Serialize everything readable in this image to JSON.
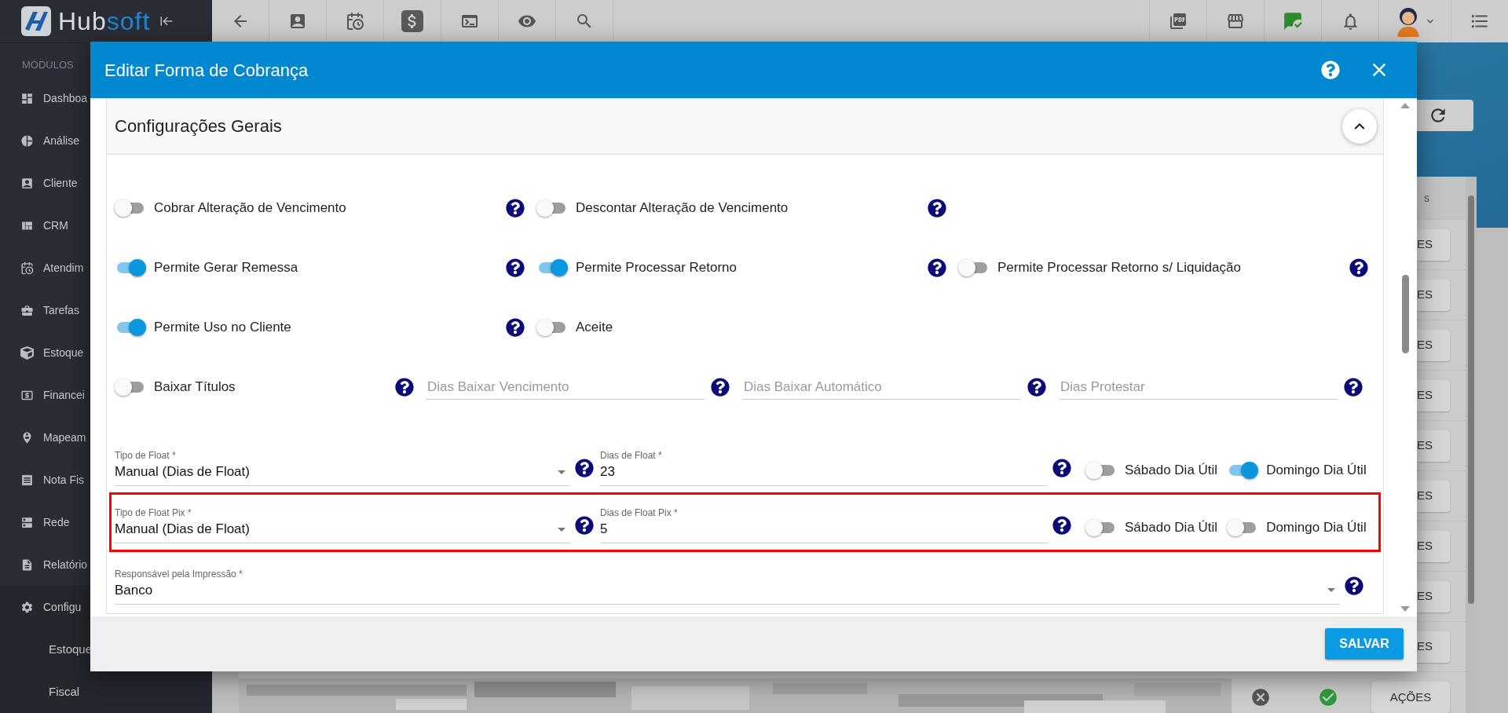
{
  "logo": {
    "first": "Hub",
    "second": "soft"
  },
  "toolbar": {
    "left": [
      {
        "selected": false
      },
      {
        "selected": false
      },
      {
        "selected": false
      },
      {
        "selected": true
      },
      {
        "selected": false
      },
      {
        "selected": false
      },
      {
        "selected": false
      }
    ]
  },
  "sidebar": {
    "heading": "MÓDULOS",
    "items": [
      {
        "label": "Dashboa"
      },
      {
        "label": "Análise"
      },
      {
        "label": "Cliente"
      },
      {
        "label": "CRM"
      },
      {
        "label": "Atendim"
      },
      {
        "label": "Tarefas"
      },
      {
        "label": "Estoque"
      },
      {
        "label": "Financei"
      },
      {
        "label": "Mapeam"
      },
      {
        "label": "Nota Fis"
      },
      {
        "label": "Rede"
      },
      {
        "label": "Relatório"
      },
      {
        "label": "Configu",
        "expanded": true,
        "children": [
          {
            "label": "Estoque"
          },
          {
            "label": "Fiscal"
          }
        ]
      }
    ]
  },
  "background_table": {
    "header": "s",
    "row_buttons": [
      "ES",
      "ES",
      "ES",
      "ES",
      "ES",
      "ES",
      "ES",
      "ES",
      "ES"
    ],
    "last_row_button": "AÇÕES"
  },
  "modal": {
    "title": "Editar Forma de Cobrança",
    "section": {
      "title": "Configurações Gerais",
      "expanded": true
    },
    "rows": [
      {
        "highlighted": false,
        "items": [
          {
            "kind": "toggle",
            "label": "Cobrar Alteração de Vencimento",
            "on": false,
            "help": true
          },
          {
            "kind": "toggle",
            "label": "Descontar Alteração de Vencimento",
            "on": false,
            "help": true
          }
        ]
      },
      {
        "highlighted": false,
        "items": [
          {
            "kind": "toggle",
            "label": "Permite Gerar Remessa",
            "on": true,
            "help": true
          },
          {
            "kind": "toggle",
            "label": "Permite Processar Retorno",
            "on": true,
            "help": true
          },
          {
            "kind": "toggle",
            "label": "Permite Processar Retorno s/ Liquidação",
            "on": false,
            "help": true
          }
        ]
      },
      {
        "highlighted": false,
        "items": [
          {
            "kind": "toggle",
            "label": "Permite Uso no Cliente",
            "on": true,
            "help": true
          },
          {
            "kind": "toggle",
            "label": "Aceite",
            "on": false,
            "help": false
          }
        ]
      },
      {
        "highlighted": false,
        "items": [
          {
            "kind": "toggle",
            "label": "Baixar Títulos",
            "on": false,
            "help": true
          },
          {
            "kind": "text_field",
            "placeholder": "Dias Baixar Vencimento",
            "help": true
          },
          {
            "kind": "text_field",
            "placeholder": "Dias Baixar Automático",
            "help": true
          },
          {
            "kind": "text_field",
            "placeholder": "Dias Protestar",
            "help": true
          }
        ]
      },
      {
        "highlighted": false,
        "items": [
          {
            "kind": "select",
            "label": "Tipo de Float *",
            "value": "Manual (Dias de Float)",
            "help": true
          },
          {
            "kind": "text_field",
            "label": "Dias de Float *",
            "value": "23",
            "help": true
          },
          {
            "kind": "toggle",
            "label": "Sábado Dia Útil",
            "on": false
          },
          {
            "kind": "toggle",
            "label": "Domingo Dia Útil",
            "on": true
          }
        ]
      },
      {
        "highlighted": true,
        "items": [
          {
            "kind": "select",
            "label": "Tipo de Float Pix *",
            "value": "Manual (Dias de Float)",
            "help": true
          },
          {
            "kind": "text_field",
            "label": "Dias de Float Pix *",
            "value": "5",
            "help": true
          },
          {
            "kind": "toggle",
            "label": "Sábado Dia Útil",
            "on": false
          },
          {
            "kind": "toggle",
            "label": "Domingo Dia Útil",
            "on": false
          }
        ]
      },
      {
        "highlighted": false,
        "items": [
          {
            "kind": "select",
            "label": "Responsável pela Impressão *",
            "value": "Banco",
            "help": true
          }
        ]
      }
    ],
    "save_button": "SALVAR"
  }
}
